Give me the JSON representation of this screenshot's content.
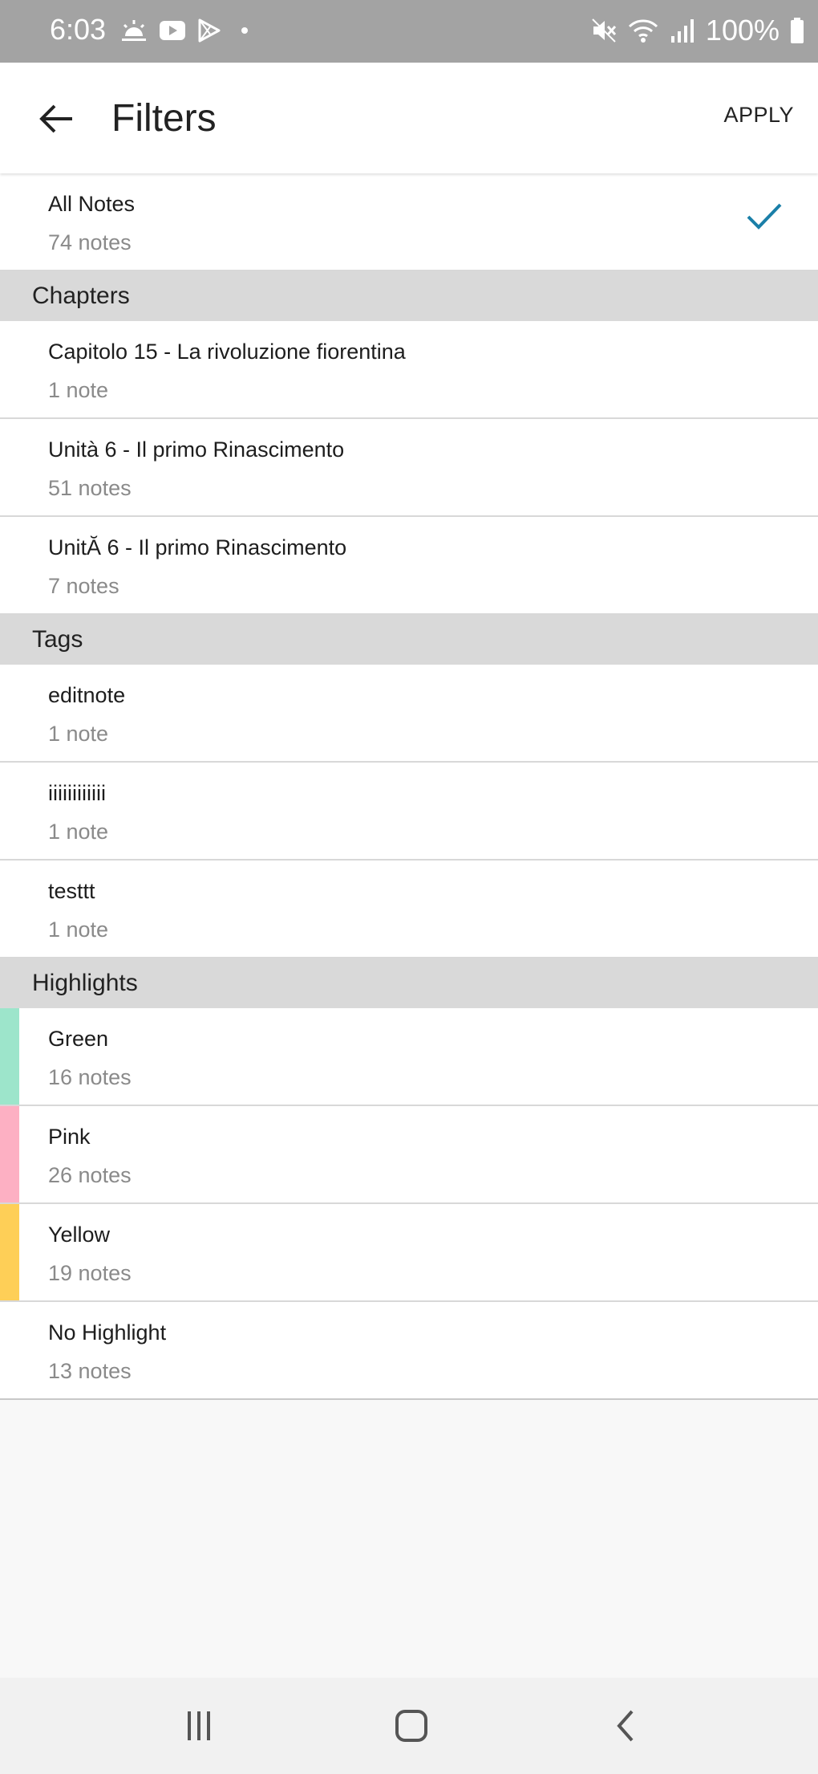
{
  "status_bar": {
    "time": "6:03",
    "battery": "100%",
    "left_icons": [
      "weather-icon",
      "youtube-icon",
      "play-store-icon",
      "dot-icon"
    ],
    "right_icons": [
      "mute-icon",
      "wifi-icon",
      "signal-icon",
      "battery-icon"
    ]
  },
  "app_bar": {
    "title": "Filters",
    "apply_label": "APPLY",
    "back_icon": "arrow-left-icon"
  },
  "all_notes": {
    "title": "All Notes",
    "count": "74 notes",
    "selected": true
  },
  "chapters": {
    "header": "Chapters",
    "items": [
      {
        "title": "Capitolo 15 - La rivoluzione fiorentina",
        "count": "1 note"
      },
      {
        "title": "Unità 6 - Il primo Rinascimento",
        "count": "51 notes"
      },
      {
        "title": "UnitĂ  6 - Il primo Rinascimento",
        "count": "7 notes"
      }
    ]
  },
  "tags": {
    "header": "Tags",
    "items": [
      {
        "title": "editnote",
        "count": "1 note"
      },
      {
        "title": "iiiiiiiiiiii",
        "count": "1 note"
      },
      {
        "title": "testtt",
        "count": "1 note"
      }
    ]
  },
  "highlights": {
    "header": "Highlights",
    "items": [
      {
        "title": "Green",
        "count": "16 notes",
        "color": "#9de5cb"
      },
      {
        "title": "Pink",
        "count": "26 notes",
        "color": "#fdb0c3"
      },
      {
        "title": "Yellow",
        "count": "19 notes",
        "color": "#fecf57"
      },
      {
        "title": "No Highlight",
        "count": "13 notes",
        "color": ""
      }
    ]
  },
  "colors": {
    "check": "#1a7fa8",
    "section_bg": "#d9d9d9",
    "status_bar_bg": "#a3a3a3"
  },
  "nav_bar": {
    "icons": [
      "recent-apps-icon",
      "home-icon",
      "back-icon"
    ]
  }
}
